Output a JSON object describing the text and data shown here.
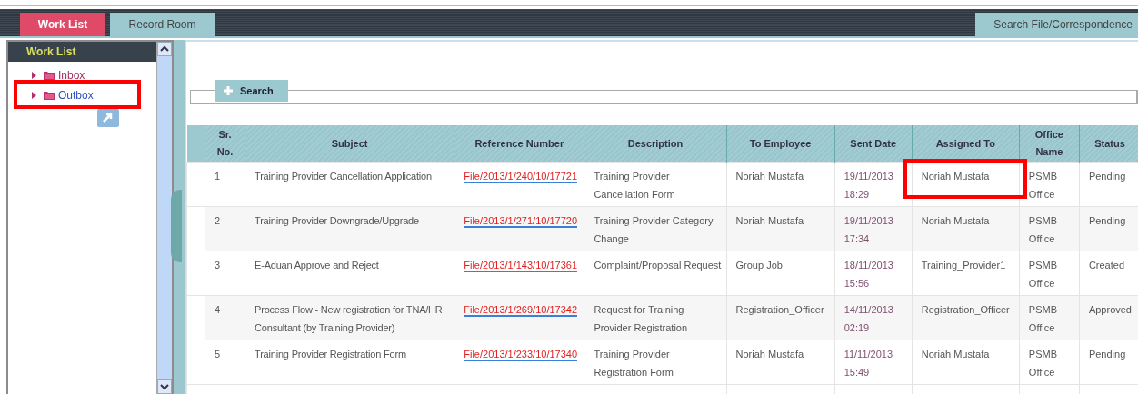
{
  "tabs": [
    {
      "label": "Work List",
      "selected": true
    },
    {
      "label": "Record Room",
      "selected": false
    }
  ],
  "search_tab": {
    "label": "Search File/Correspondence"
  },
  "sidebar": {
    "title": "Work List",
    "items": [
      {
        "label": "Inbox",
        "highlighted": false
      },
      {
        "label": "Outbox",
        "highlighted": true
      }
    ]
  },
  "search": {
    "label": "Search"
  },
  "table": {
    "columns": [
      "",
      "Sr. No.",
      "Subject",
      "Reference Number",
      "Description",
      "To Employee",
      "Sent Date",
      "Assigned To",
      "Office Name",
      "Status"
    ],
    "rows": [
      {
        "sr": "1",
        "subject": "Training Provider Cancellation Application",
        "reference": "File/2013/1/240/10/17721",
        "description": "Training Provider Cancellation Form",
        "to_employee": "Noriah Mustafa",
        "sent_date": "19/11/2013 18:29",
        "assigned_to": "Noriah Mustafa",
        "assigned_highlighted": true,
        "office": "PSMB Office",
        "status": "Pending"
      },
      {
        "sr": "2",
        "subject": "Training Provider Downgrade/Upgrade",
        "reference": "File/2013/1/271/10/17720",
        "description": "Training Provider Category Change",
        "to_employee": "Noriah Mustafa",
        "sent_date": "19/11/2013 17:34",
        "assigned_to": "Noriah Mustafa",
        "assigned_highlighted": false,
        "office": "PSMB Office",
        "status": "Pending"
      },
      {
        "sr": "3",
        "subject": "E-Aduan Approve and Reject",
        "reference": "File/2013/1/143/10/17361",
        "description": "Complaint/Proposal Request",
        "to_employee": "Group Job",
        "sent_date": "18/11/2013 15:56",
        "assigned_to": "Training_Provider1",
        "assigned_highlighted": false,
        "office": "PSMB Office",
        "status": "Created"
      },
      {
        "sr": "4",
        "subject": "Process Flow - New registration for TNA/HR Consultant (by Training Provider)",
        "reference": "File/2013/1/269/10/17342",
        "description": "Request for Training Provider Registration",
        "to_employee": "Registration_Officer",
        "sent_date": "14/11/2013 02:19",
        "assigned_to": "Registration_Officer",
        "assigned_highlighted": false,
        "office": "PSMB Office",
        "status": "Approved"
      },
      {
        "sr": "5",
        "subject": "Training Provider Registration Form",
        "reference": "File/2013/1/233/10/17340",
        "description": "Training Provider Registration Form",
        "to_employee": "Noriah Mustafa",
        "sent_date": "11/11/2013 15:49",
        "assigned_to": "Noriah Mustafa",
        "assigned_highlighted": false,
        "office": "PSMB Office",
        "status": "Pending"
      }
    ]
  }
}
